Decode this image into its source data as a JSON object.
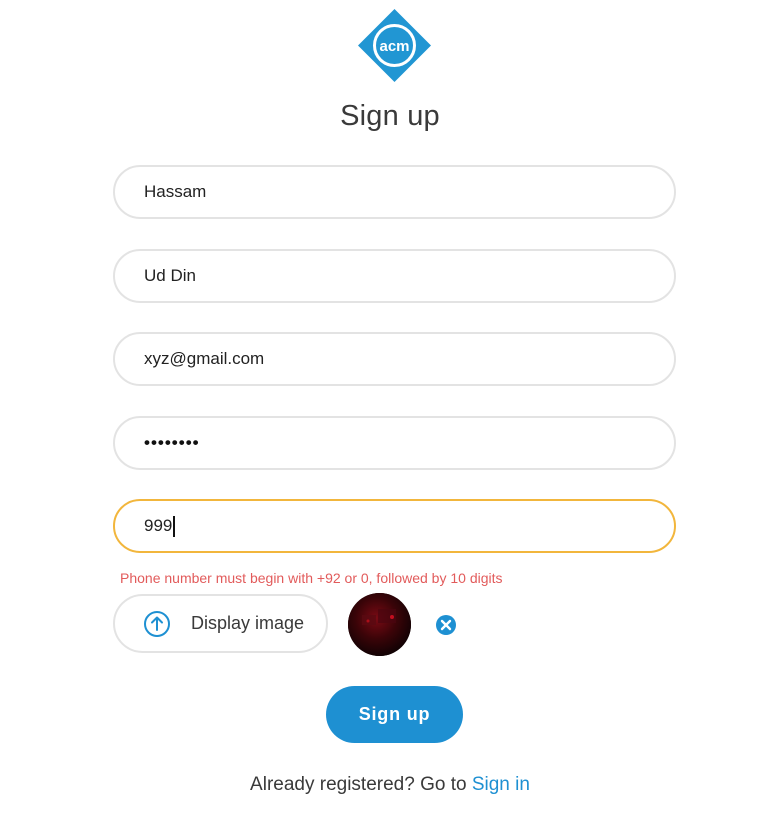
{
  "logo": {
    "text": "acm",
    "color": "#2196d3",
    "icon": "acm-logo"
  },
  "page_title": "Sign up",
  "form": {
    "first_name": {
      "value": "Hassam"
    },
    "last_name": {
      "value": "Ud Din"
    },
    "email": {
      "value": "xyz@gmail.com"
    },
    "password": {
      "value": "••••••••"
    },
    "phone": {
      "value": "999",
      "focused": true,
      "focus_color": "#f2b63c"
    },
    "error_message": "Phone number must begin with +92 or 0, followed by 10 digits",
    "error_color": "#e25b5b",
    "upload": {
      "label": "Display image",
      "icon": "upload-arrow-icon"
    },
    "avatar": {
      "icon": "avatar-preview"
    },
    "remove_icon": "close-circle-icon",
    "submit_label": "Sign up"
  },
  "footer": {
    "text": "Already registered? Go to ",
    "link_label": "Sign in"
  },
  "colors": {
    "accent": "#1e90d2",
    "border": "#e3e3e3"
  }
}
